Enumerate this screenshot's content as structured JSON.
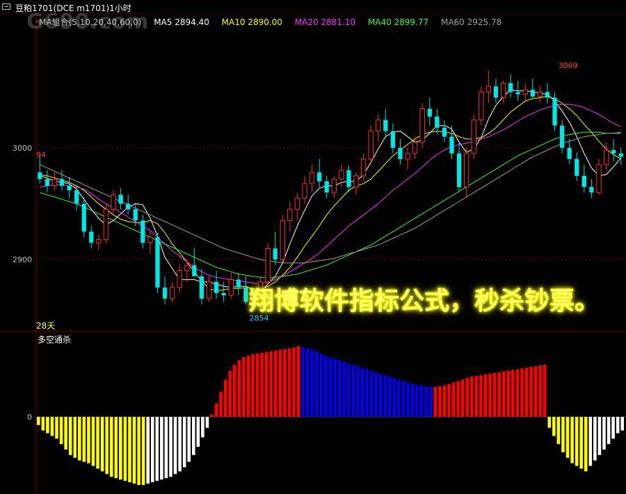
{
  "window": {
    "title": "豆粕1701(DCE m1701)1小时",
    "watermark": "G690.com"
  },
  "ma_legend": [
    {
      "label": "MA组合(5,10,20,40,60,0)",
      "color": "#c0c0c0"
    },
    {
      "label": "MA5 2894.40",
      "color": "#ffffff"
    },
    {
      "label": "MA10 2890.00",
      "color": "#ffff00"
    },
    {
      "label": "MA20 2881.10",
      "color": "#ff33ff"
    },
    {
      "label": "MA40 2899.77",
      "color": "#33ff33"
    },
    {
      "label": "MA60 2925.78",
      "color": "#a0a0a0"
    }
  ],
  "promo_text": "翔博软件指标公式，秒杀钞票。",
  "period_label": "28天",
  "indicator": {
    "title": "多空通杀",
    "zero_label": "0"
  },
  "chart_data": [
    {
      "type": "candlestick",
      "y_ticks": [
        2900,
        3000
      ],
      "ylim": [
        2840,
        3110
      ],
      "annotations": [
        {
          "text": "3069",
          "x": 72,
          "y": 3069,
          "color": "#ff4444"
        },
        {
          "text": "2854",
          "x": 30,
          "y": 2854,
          "color": "#33ccff"
        },
        {
          "text": "94",
          "x": 0,
          "y": 2994,
          "color": "#ff4444"
        }
      ],
      "colors": {
        "up": "#ff3030",
        "down": "#00e5e5",
        "ma5": "#ffffff",
        "ma10": "#ffff00",
        "ma20": "#ff33ff",
        "ma40": "#33ff33",
        "ma60": "#a0a0a0"
      },
      "candles": [
        [
          2978,
          2994,
          2968,
          2972
        ],
        [
          2972,
          2980,
          2960,
          2966
        ],
        [
          2966,
          2978,
          2962,
          2972
        ],
        [
          2972,
          2980,
          2962,
          2966
        ],
        [
          2966,
          2974,
          2955,
          2962
        ],
        [
          2962,
          2966,
          2944,
          2950
        ],
        [
          2950,
          2956,
          2920,
          2925
        ],
        [
          2925,
          2930,
          2910,
          2915
        ],
        [
          2915,
          2922,
          2908,
          2918
        ],
        [
          2918,
          2950,
          2915,
          2945
        ],
        [
          2945,
          2962,
          2940,
          2958
        ],
        [
          2958,
          2964,
          2945,
          2950
        ],
        [
          2950,
          2958,
          2940,
          2945
        ],
        [
          2945,
          2950,
          2930,
          2935
        ],
        [
          2935,
          2940,
          2910,
          2915
        ],
        [
          2915,
          2925,
          2905,
          2920
        ],
        [
          2920,
          2924,
          2870,
          2875
        ],
        [
          2875,
          2885,
          2860,
          2865
        ],
        [
          2865,
          2880,
          2862,
          2875
        ],
        [
          2875,
          2896,
          2870,
          2890
        ],
        [
          2890,
          2900,
          2880,
          2895
        ],
        [
          2895,
          2910,
          2885,
          2885
        ],
        [
          2885,
          2892,
          2860,
          2865
        ],
        [
          2865,
          2885,
          2862,
          2880
        ],
        [
          2880,
          2890,
          2865,
          2870
        ],
        [
          2870,
          2880,
          2862,
          2868
        ],
        [
          2868,
          2888,
          2865,
          2882
        ],
        [
          2882,
          2888,
          2868,
          2875
        ],
        [
          2875,
          2885,
          2860,
          2862
        ],
        [
          2862,
          2870,
          2854,
          2858
        ],
        [
          2858,
          2885,
          2856,
          2880
        ],
        [
          2880,
          2915,
          2878,
          2910
        ],
        [
          2910,
          2925,
          2895,
          2900
        ],
        [
          2900,
          2940,
          2898,
          2935
        ],
        [
          2935,
          2952,
          2925,
          2945
        ],
        [
          2945,
          2960,
          2935,
          2955
        ],
        [
          2955,
          2975,
          2950,
          2968
        ],
        [
          2968,
          2985,
          2960,
          2978
        ],
        [
          2978,
          2990,
          2965,
          2970
        ],
        [
          2970,
          2975,
          2955,
          2960
        ],
        [
          2960,
          2975,
          2955,
          2972
        ],
        [
          2972,
          2985,
          2965,
          2980
        ],
        [
          2980,
          2984,
          2960,
          2965
        ],
        [
          2965,
          2978,
          2958,
          2975
        ],
        [
          2975,
          2995,
          2970,
          2990
        ],
        [
          2990,
          3020,
          2985,
          3015
        ],
        [
          3015,
          3030,
          3005,
          3025
        ],
        [
          3025,
          3035,
          3010,
          3015
        ],
        [
          3015,
          3022,
          2995,
          3000
        ],
        [
          3000,
          3008,
          2985,
          2990
        ],
        [
          2990,
          3000,
          2980,
          2995
        ],
        [
          2995,
          3010,
          2990,
          3005
        ],
        [
          3005,
          3040,
          3000,
          3035
        ],
        [
          3035,
          3045,
          3020,
          3028
        ],
        [
          3028,
          3035,
          3012,
          3018
        ],
        [
          3018,
          3025,
          3005,
          3010
        ],
        [
          3010,
          3020,
          2990,
          2995
        ],
        [
          2995,
          3005,
          2960,
          2965
        ],
        [
          2965,
          3000,
          2955,
          2995
        ],
        [
          2995,
          3030,
          2990,
          3025
        ],
        [
          3025,
          3055,
          3020,
          3050
        ],
        [
          3050,
          3069,
          3040,
          3055
        ],
        [
          3055,
          3062,
          3040,
          3045
        ],
        [
          3045,
          3060,
          3040,
          3058
        ],
        [
          3058,
          3066,
          3045,
          3050
        ],
        [
          3050,
          3060,
          3042,
          3048
        ],
        [
          3048,
          3058,
          3040,
          3052
        ],
        [
          3052,
          3062,
          3044,
          3046
        ],
        [
          3046,
          3056,
          3040,
          3050
        ],
        [
          3050,
          3058,
          3040,
          3045
        ],
        [
          3045,
          3050,
          3015,
          3020
        ],
        [
          3020,
          3025,
          2995,
          3000
        ],
        [
          3000,
          3008,
          2985,
          2990
        ],
        [
          2990,
          2996,
          2970,
          2975
        ],
        [
          2975,
          2985,
          2960,
          2965
        ],
        [
          2965,
          2972,
          2955,
          2960
        ],
        [
          2960,
          2990,
          2958,
          2985
        ],
        [
          2985,
          3005,
          2980,
          2998
        ],
        [
          2998,
          3008,
          2988,
          2995
        ],
        [
          2995,
          3000,
          2985,
          2992
        ]
      ],
      "series": [
        {
          "key": "ma5",
          "values": [
            2975,
            2973,
            2970,
            2969,
            2968,
            2963,
            2954,
            2945,
            2937,
            2931,
            2935,
            2941,
            2947,
            2950,
            2949,
            2937,
            2921,
            2902,
            2892,
            2882,
            2882,
            2882,
            2880,
            2880,
            2878,
            2876,
            2875,
            2876,
            2876,
            2873,
            2871,
            2878,
            2885,
            2897,
            2914,
            2930,
            2944,
            2957,
            2964,
            2966,
            2966,
            2969,
            2970,
            2970,
            2976,
            2987,
            2999,
            3010,
            3014,
            3015,
            3010,
            3005,
            3007,
            3013,
            3020,
            3020,
            3017,
            3005,
            2996,
            2999,
            3009,
            3026,
            3038,
            3046,
            3052,
            3051,
            3051,
            3050,
            3049,
            3048,
            3042,
            3033,
            3023,
            3010,
            2995,
            2982,
            2975,
            2976,
            2983,
            2991
          ]
        },
        {
          "key": "ma10",
          "values": [
            2976,
            2975,
            2973,
            2971,
            2969,
            2966,
            2962,
            2956,
            2950,
            2945,
            2940,
            2936,
            2934,
            2933,
            2933,
            2935,
            2932,
            2924,
            2914,
            2906,
            2898,
            2889,
            2881,
            2874,
            2872,
            2873,
            2874,
            2874,
            2875,
            2874,
            2873,
            2876,
            2880,
            2886,
            2893,
            2902,
            2912,
            2921,
            2930,
            2940,
            2948,
            2955,
            2962,
            2966,
            2968,
            2972,
            2979,
            2986,
            2993,
            2998,
            3003,
            3008,
            3012,
            3014,
            3015,
            3014,
            3013,
            3010,
            3008,
            3008,
            3009,
            3013,
            3018,
            3025,
            3032,
            3037,
            3042,
            3044,
            3045,
            3046,
            3044,
            3040,
            3035,
            3029,
            3021,
            3014,
            3006,
            2999,
            2994,
            2990
          ]
        },
        {
          "key": "ma20",
          "values": [
            2965,
            2966,
            2967,
            2967,
            2966,
            2965,
            2963,
            2959,
            2954,
            2950,
            2946,
            2942,
            2938,
            2934,
            2930,
            2926,
            2920,
            2914,
            2908,
            2903,
            2898,
            2893,
            2889,
            2886,
            2884,
            2883,
            2882,
            2881,
            2880,
            2879,
            2878,
            2880,
            2882,
            2885,
            2889,
            2893,
            2897,
            2901,
            2906,
            2912,
            2918,
            2924,
            2930,
            2935,
            2940,
            2945,
            2950,
            2956,
            2962,
            2967,
            2972,
            2977,
            2983,
            2989,
            2994,
            2998,
            3001,
            3003,
            3004,
            3006,
            3008,
            3010,
            3013,
            3016,
            3020,
            3024,
            3028,
            3031,
            3034,
            3036,
            3038,
            3039,
            3039,
            3038,
            3036,
            3033,
            3030,
            3026,
            3022,
            3019
          ]
        },
        {
          "key": "ma40",
          "values": [
            2960,
            2958,
            2956,
            2954,
            2952,
            2950,
            2947,
            2944,
            2941,
            2938,
            2935,
            2932,
            2929,
            2926,
            2923,
            2920,
            2917,
            2914,
            2911,
            2908,
            2905,
            2902,
            2899,
            2896,
            2893,
            2891,
            2889,
            2887,
            2886,
            2885,
            2884,
            2884,
            2884,
            2885,
            2886,
            2887,
            2889,
            2891,
            2893,
            2895,
            2898,
            2901,
            2904,
            2907,
            2910,
            2913,
            2917,
            2921,
            2925,
            2929,
            2933,
            2937,
            2941,
            2945,
            2949,
            2953,
            2957,
            2961,
            2965,
            2969,
            2973,
            2977,
            2981,
            2985,
            2989,
            2993,
            2996,
            2999,
            3002,
            3005,
            3008,
            3010,
            3012,
            3013,
            3014,
            3014,
            3014,
            3013,
            3013,
            3013
          ]
        },
        {
          "key": "ma60",
          "values": [
            2985,
            2982,
            2979,
            2976,
            2973,
            2970,
            2967,
            2964,
            2961,
            2958,
            2955,
            2952,
            2949,
            2946,
            2943,
            2940,
            2937,
            2934,
            2931,
            2928,
            2925,
            2922,
            2919,
            2916,
            2913,
            2910,
            2908,
            2906,
            2904,
            2902,
            2900,
            2899,
            2898,
            2897,
            2897,
            2897,
            2897,
            2898,
            2899,
            2900,
            2901,
            2903,
            2905,
            2907,
            2909,
            2911,
            2913,
            2916,
            2919,
            2922,
            2925,
            2928,
            2932,
            2936,
            2940,
            2944,
            2948,
            2952,
            2956,
            2960,
            2964,
            2968,
            2972,
            2976,
            2980,
            2984,
            2988,
            2992,
            2995,
            2998,
            3001,
            3004,
            3006,
            3008,
            3010,
            3011,
            3012,
            3013,
            3013,
            3014
          ]
        }
      ]
    },
    {
      "type": "bar",
      "values": [
        -6,
        -10,
        -12,
        -14,
        -16,
        -20,
        -24,
        -28,
        -30,
        -32,
        -33,
        -34,
        -36,
        -38,
        -40,
        -42,
        -44,
        -45,
        -46,
        -47,
        -48,
        -49,
        -50,
        -50,
        -49,
        -48,
        -47,
        -46,
        -45,
        -44,
        -42,
        -40,
        -37,
        -33,
        -28,
        -22,
        -15,
        -8,
        3,
        18,
        34,
        50,
        62,
        70,
        76,
        80,
        82,
        84,
        85,
        86,
        87,
        88,
        89,
        90,
        91,
        92,
        93,
        95,
        94,
        92,
        90,
        88,
        85,
        82,
        80,
        78,
        76,
        74,
        72,
        70,
        68,
        66,
        64,
        62,
        60,
        58,
        56,
        54,
        52,
        50,
        48,
        46,
        44,
        43,
        42,
        41,
        40,
        40,
        41,
        42,
        44,
        46,
        48,
        50,
        52,
        54,
        55,
        56,
        57,
        58,
        59,
        60,
        61,
        62,
        63,
        64,
        65,
        66,
        67,
        68,
        69,
        70,
        -8,
        -14,
        -20,
        -26,
        -30,
        -34,
        -36,
        -38,
        -40,
        -36,
        -32,
        -28,
        -24,
        -20,
        -16,
        -12,
        -10
      ],
      "colors": {
        "red": "#ff0000",
        "blue": "#0000ee",
        "white": "#ffffff",
        "yellow": "#ffff00"
      }
    }
  ]
}
